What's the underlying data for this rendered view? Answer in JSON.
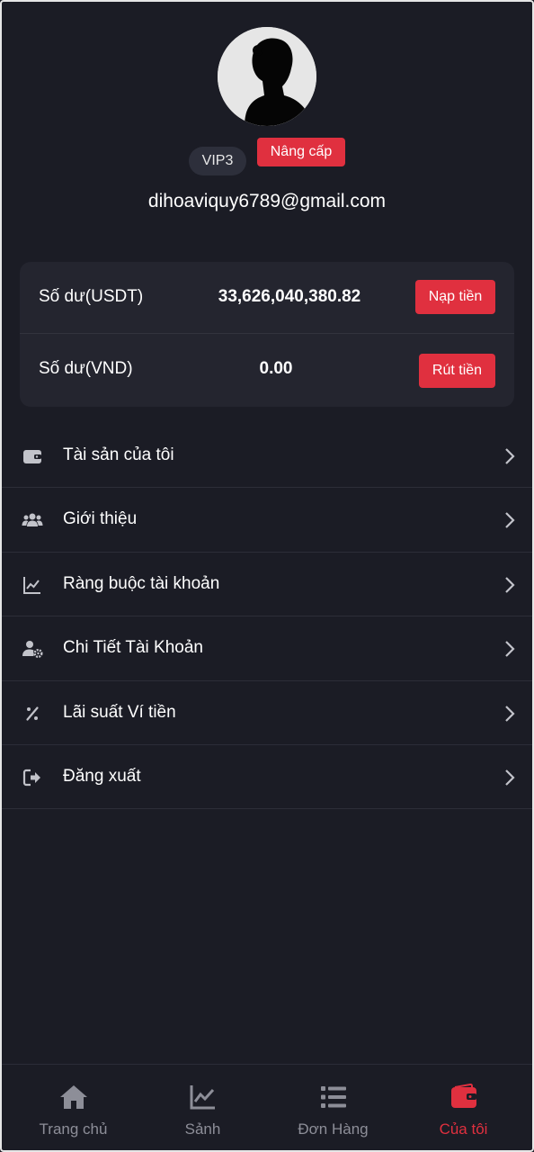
{
  "profile": {
    "vip_level": "VIP3",
    "upgrade_label": "Nâng cấp",
    "email": "dihoaviquy6789@gmail.com"
  },
  "balances": [
    {
      "label": "Số dư(USDT)",
      "value": "33,626,040,380.82",
      "action": "Nạp tiền"
    },
    {
      "label": "Số dư(VND)",
      "value": "0.00",
      "action": "Rút tiền"
    }
  ],
  "menu": [
    {
      "label": "Tài sản của tôi",
      "icon": "wallet-icon"
    },
    {
      "label": "Giới thiệu",
      "icon": "users-icon"
    },
    {
      "label": "Ràng buộc tài khoản",
      "icon": "chart-line-icon"
    },
    {
      "label": "Chi Tiết Tài Khoản",
      "icon": "user-gear-icon"
    },
    {
      "label": "Lãi suất Ví tiền",
      "icon": "percent-icon"
    },
    {
      "label": "Đăng xuất",
      "icon": "logout-icon"
    }
  ],
  "nav": [
    {
      "label": "Trang chủ",
      "icon": "home-icon",
      "active": false
    },
    {
      "label": "Sảnh",
      "icon": "chart-line-icon",
      "active": false
    },
    {
      "label": "Đơn Hàng",
      "icon": "list-icon",
      "active": false
    },
    {
      "label": "Của tôi",
      "icon": "wallet-icon",
      "active": true
    }
  ],
  "colors": {
    "background": "#1b1c25",
    "card": "#24252f",
    "accent": "#e0303f",
    "muted": "#8d8e98"
  }
}
